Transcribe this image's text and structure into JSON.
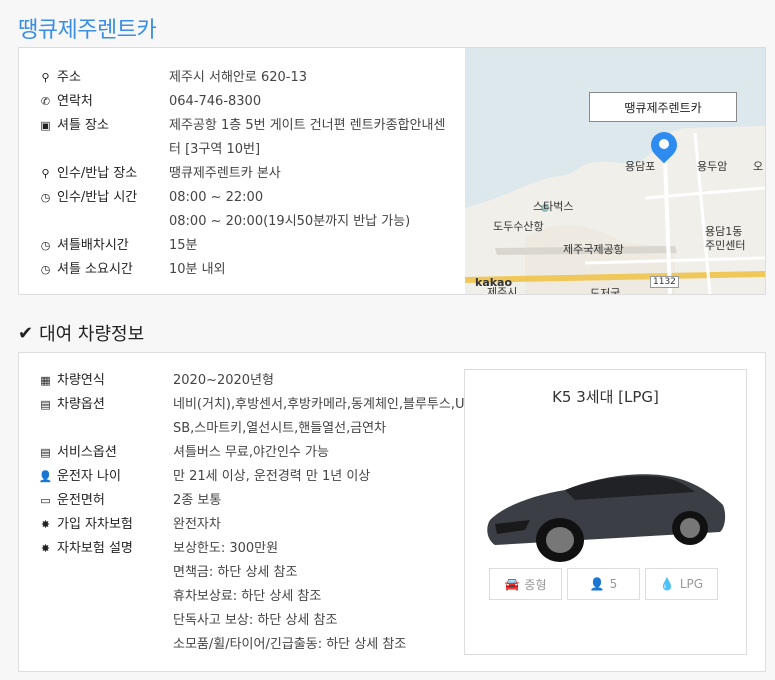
{
  "page_title": "땡큐제주렌트카",
  "rental_info": [
    {
      "icon": "map-marker-icon",
      "label": "주소",
      "values": [
        "제주시 서해안로 620-13"
      ]
    },
    {
      "icon": "phone-icon",
      "label": "연락처",
      "values": [
        "064-746-8300"
      ]
    },
    {
      "icon": "bus-icon",
      "label": "셔틀 장소",
      "values": [
        "제주공항 1층 5번 게이트 건너편 렌트카종합안내센",
        "터 [3구역 10번]"
      ]
    },
    {
      "icon": "map-marker-icon",
      "label": "인수/반납 장소",
      "values": [
        "땡큐제주렌트카 본사"
      ]
    },
    {
      "icon": "clock-icon",
      "label": "인수/반납 시간",
      "values": [
        "08:00 ~ 22:00",
        "08:00 ~ 20:00(19시50분까지 반납 가능)"
      ]
    },
    {
      "icon": "clock-icon",
      "label": "셔틀배차시간",
      "values": [
        "15분"
      ]
    },
    {
      "icon": "clock-icon",
      "label": "셔틀 소요시간",
      "values": [
        "10분 내외"
      ]
    }
  ],
  "map": {
    "popup": "땡큐제주렌트카",
    "logo": "kakao",
    "places": [
      "용담포",
      "용두암",
      "오",
      "스타벅스",
      "도두수산항",
      "용담1동",
      "주민센터",
      "제주국제공항",
      "1132",
      "도두봉",
      "도저굴",
      "제주시",
      "내",
      "봉",
      "제주 시"
    ]
  },
  "section_title": "대여 차량정보",
  "car_info": [
    {
      "icon": "calendar-check-icon",
      "label": "차량연식",
      "values": [
        "2020~2020년형"
      ]
    },
    {
      "icon": "clipboard-icon",
      "label": "차량옵션",
      "values": [
        "네비(거치),후방센서,후방카메라,동계체인,블루투스,U",
        "SB,스마트키,열선시트,핸들열선,금연차"
      ]
    },
    {
      "icon": "clipboard-icon",
      "label": "서비스옵션",
      "values": [
        "셔틀버스 무료,야간인수 가능"
      ]
    },
    {
      "icon": "user-check-icon",
      "label": "운전자 나이",
      "values": [
        "만 21세 이상, 운전경력 만 1년 이상"
      ]
    },
    {
      "icon": "id-card-icon",
      "label": "운전면허",
      "values": [
        "2종 보통"
      ]
    },
    {
      "icon": "car-crash-icon",
      "label": "가입 자차보험",
      "values": [
        "완전자차"
      ]
    },
    {
      "icon": "car-crash-icon",
      "label": "자차보험 설명",
      "values": [
        "보상한도: 300만원",
        "면책금: 하단 상세 참조",
        "휴차보상료: 하단 상세 참조",
        "단독사고 보상: 하단 상세 참조",
        "소모품/휠/타이어/긴급출동: 하단 상세 참조"
      ]
    }
  ],
  "car": {
    "name": "K5 3세대 [LPG]",
    "chips": [
      {
        "icon": "car-icon",
        "label": "중형"
      },
      {
        "icon": "user-icon",
        "label": "5"
      },
      {
        "icon": "droplet-icon",
        "label": "LPG"
      }
    ]
  }
}
